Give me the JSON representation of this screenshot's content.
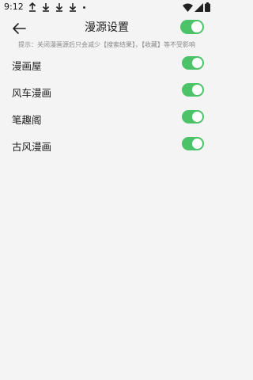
{
  "status_bar": {
    "time": "9:12",
    "notification_icons": [
      "upload-icon",
      "download-icon",
      "download-icon",
      "download-icon"
    ],
    "right_icons": [
      "wifi-icon",
      "signal-icon",
      "battery-icon"
    ]
  },
  "header": {
    "title": "漫源设置",
    "back_icon": "arrow-left-icon",
    "master_toggle_on": true
  },
  "hint": "提示：关闭漫画源后只会减少【搜索结果】，【收藏】等不受影响",
  "sources": [
    {
      "label": "漫画屋",
      "enabled": true
    },
    {
      "label": "风车漫画",
      "enabled": true
    },
    {
      "label": "笔趣阁",
      "enabled": true
    },
    {
      "label": "古风漫画",
      "enabled": true
    }
  ],
  "colors": {
    "toggle_on": "#4cc368",
    "background": "#f4f4f4",
    "hint_text": "#888888"
  }
}
